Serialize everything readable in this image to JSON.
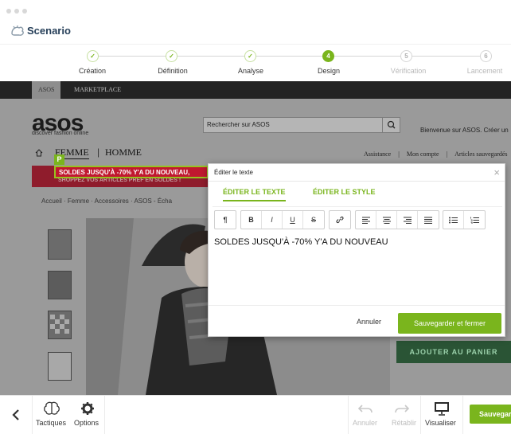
{
  "app": {
    "title": "Scenario"
  },
  "steps": [
    {
      "label": "Création",
      "status": "done",
      "marker": "✓"
    },
    {
      "label": "Définition",
      "status": "done",
      "marker": "✓"
    },
    {
      "label": "Analyse",
      "status": "done",
      "marker": "✓"
    },
    {
      "label": "Design",
      "status": "active",
      "marker": "4"
    },
    {
      "label": "Vérification",
      "status": "todo",
      "marker": "5"
    },
    {
      "label": "Lancement",
      "status": "todo",
      "marker": "6"
    }
  ],
  "site": {
    "tabs": [
      "ASOS",
      "MARKETPLACE"
    ],
    "logo": "asos",
    "tagline": "discover fashion online",
    "search_value": "Rechercher sur ASOS",
    "welcome": "Bienvenue sur ASOS.  Créer un",
    "nav": [
      "FEMME",
      "|",
      "HOMME"
    ],
    "util_links": [
      "Assistance",
      "|",
      "Mon compte",
      "|",
      "Articles sauvegardés"
    ],
    "promo_banner": "SOLDES JUSQU'À -70% Y'A DU NOUVEAU,",
    "promo_sub": "SHOPPEZ VOS ARTICLES PRÉF EN SOLDES !",
    "selection_badge": "P",
    "breadcrumb": "Accueil  ·  Femme  ·  Accessoires  ·  ASOS - Écha",
    "cart_button": "AJOUTER AU PANIER"
  },
  "editor": {
    "title": "Éditer le texte",
    "close": "×",
    "tabs": [
      "ÉDITER LE TEXTE",
      "ÉDITER LE STYLE"
    ],
    "toolbar": {
      "paragraph": "¶",
      "bold": "B",
      "italic": "I",
      "underline": "U",
      "strike": "S",
      "link": "🔗"
    },
    "content": "SOLDES JUSQU'À -70% Y'A DU NOUVEAU",
    "cancel": "Annuler",
    "save": "Sauvegarder et fermer"
  },
  "bottombar": {
    "back_icon": "chevron-left-icon",
    "tactics": "Tactiques",
    "options": "Options",
    "undo": "Annuler",
    "redo": "Rétablir",
    "preview": "Visualiser",
    "save": "Sauvegar"
  },
  "colors": {
    "accent": "#7ab51d",
    "brand_text": "#27405a",
    "promo": "#c0182f",
    "cart": "#2a5435"
  }
}
